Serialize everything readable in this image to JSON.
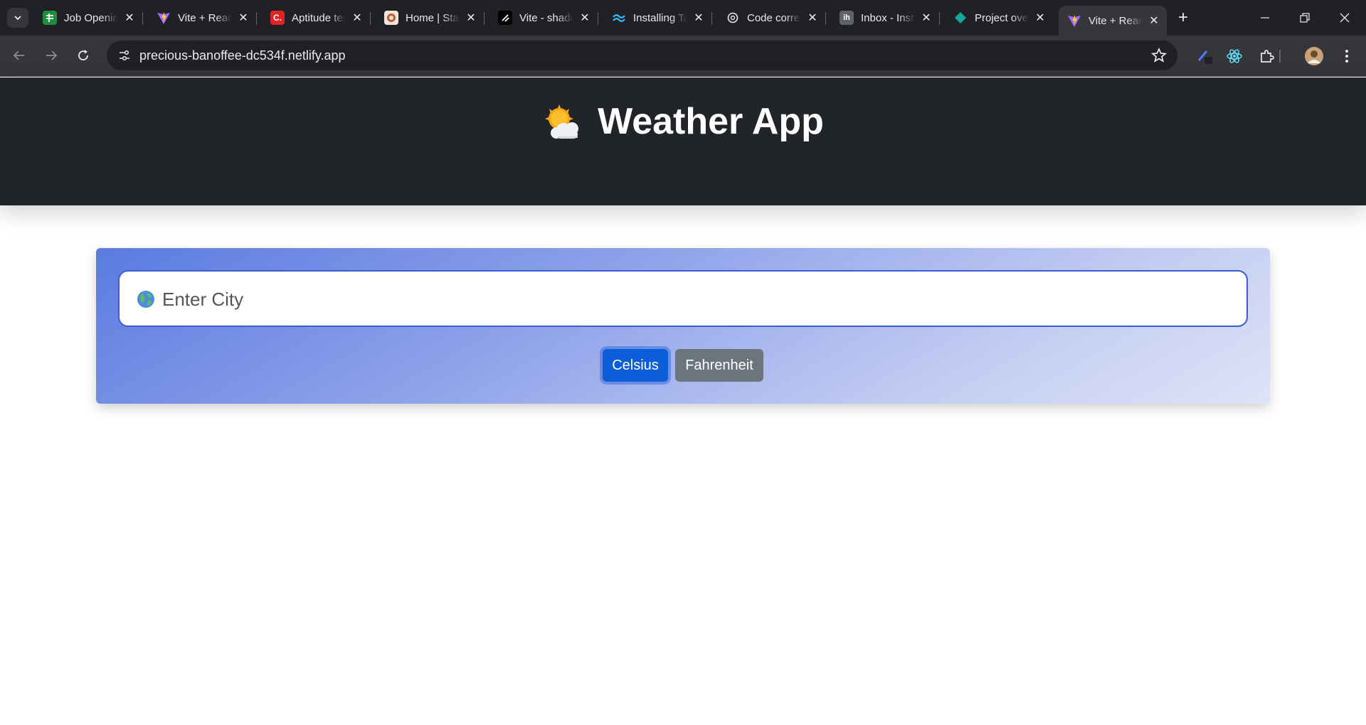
{
  "browser": {
    "tabs": [
      {
        "title": "Job Openings",
        "favicon": "sheets-icon",
        "color": "#1e8e3e"
      },
      {
        "title": "Vite + React",
        "favicon": "vite-icon",
        "color": "#9b6bff"
      },
      {
        "title": "Aptitude test",
        "favicon": "c-logo-icon",
        "color": "#e02424"
      },
      {
        "title": "Home | Start",
        "favicon": "crest-icon",
        "color": "#b85c38"
      },
      {
        "title": "Vite - shadcn",
        "favicon": "shadcn-icon",
        "color": "#000000"
      },
      {
        "title": "Installing Tailwind",
        "favicon": "tailwind-icon",
        "color": "#38bdf8"
      },
      {
        "title": "Code correction",
        "favicon": "openai-icon",
        "color": "#e8eaed"
      },
      {
        "title": "Inbox - Instahyre",
        "favicon": "ih-icon",
        "color": "#5f6368"
      },
      {
        "title": "Project overview",
        "favicon": "diamond-icon",
        "color": "#12a89d"
      },
      {
        "title": "Vite + React",
        "favicon": "vite-icon",
        "color": "#9b6bff",
        "active": true
      }
    ],
    "url": "precious-banoffee-dc534f.netlify.app"
  },
  "app": {
    "title": "Weather App",
    "search": {
      "placeholder": "Enter City",
      "value": ""
    },
    "units": {
      "celsius_label": "Celsius",
      "fahrenheit_label": "Fahrenheit",
      "selected": "Celsius"
    }
  },
  "colors": {
    "header_bg": "#212529",
    "card_gradient_start": "#5b7be0",
    "card_gradient_end": "#dfe3f7",
    "celsius_btn": "#0b5ed7",
    "fahrenheit_btn": "#6c757d"
  }
}
